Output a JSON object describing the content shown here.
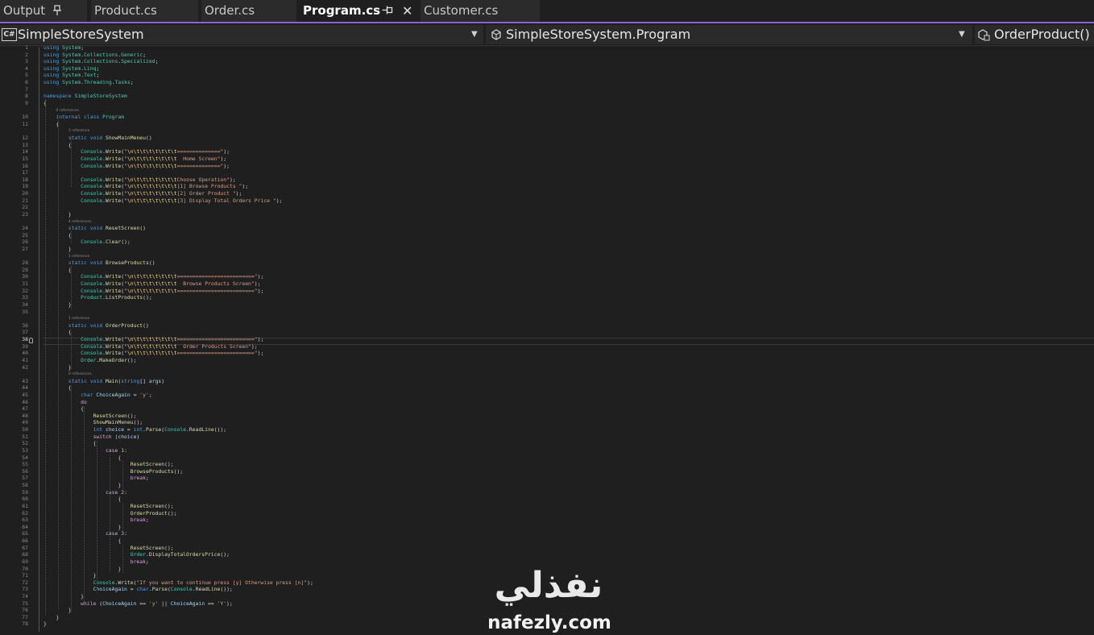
{
  "tabs": [
    {
      "label": "Output",
      "pinned": true,
      "active": false
    },
    {
      "label": "Product.cs",
      "active": false
    },
    {
      "label": "Order.cs",
      "active": false
    },
    {
      "label": "Program.cs",
      "active": true,
      "pinned": true,
      "closable": true
    },
    {
      "label": "Customer.cs",
      "active": false
    }
  ],
  "navbar": {
    "project": "SimpleStoreSystem",
    "project_icon": "C#",
    "class": "SimpleStoreSystem.Program",
    "member": "OrderProduct()"
  },
  "editor": {
    "current_line": 38,
    "colors": {
      "keyword": "#569cd6",
      "type": "#4ec9b0",
      "method": "#dcdcaa",
      "string": "#d69d85",
      "control": "#d8a0df"
    },
    "lines": [
      {
        "n": 1,
        "t": "using System;"
      },
      {
        "n": 2,
        "t": "using System.Collections.Generic;"
      },
      {
        "n": 3,
        "t": "using System.Collections.Specialized;"
      },
      {
        "n": 4,
        "t": "using System.Linq;"
      },
      {
        "n": 5,
        "t": "using System.Text;"
      },
      {
        "n": 6,
        "t": "using System.Threading.Tasks;"
      },
      {
        "n": 7,
        "t": ""
      },
      {
        "n": 8,
        "t": "namespace SimpleStoreSystem"
      },
      {
        "n": 9,
        "t": "{"
      },
      {
        "n": 10,
        "t": "    internal class Program",
        "hint": "0 references"
      },
      {
        "n": 11,
        "t": "    {"
      },
      {
        "n": 12,
        "t": "        static void ShowMainMeneu()",
        "hint": "1 reference"
      },
      {
        "n": 13,
        "t": "        {"
      },
      {
        "n": 14,
        "t": "            Console.Write(\"\\n\\t\\t\\t\\t\\t\\t\\t==============\");"
      },
      {
        "n": 15,
        "t": "            Console.Write(\"\\n\\t\\t\\t\\t\\t\\t\\t  Home Screen\");"
      },
      {
        "n": 16,
        "t": "            Console.Write(\"\\n\\t\\t\\t\\t\\t\\t\\t==============\");"
      },
      {
        "n": 17,
        "t": ""
      },
      {
        "n": 18,
        "t": "            Console.Write(\"\\n\\t\\t\\t\\t\\t\\t\\tChoose Operation\");"
      },
      {
        "n": 19,
        "t": "            Console.Write(\"\\n\\t\\t\\t\\t\\t\\t\\t[1] Browse Products \");"
      },
      {
        "n": 20,
        "t": "            Console.Write(\"\\n\\t\\t\\t\\t\\t\\t\\t[2] Order Product \");"
      },
      {
        "n": 21,
        "t": "            Console.Write(\"\\n\\t\\t\\t\\t\\t\\t\\t[3] Display Total Orders Price \");"
      },
      {
        "n": 22,
        "t": ""
      },
      {
        "n": 23,
        "t": "        }"
      },
      {
        "n": 24,
        "t": "        static void ResetScreen()",
        "hint": "4 references"
      },
      {
        "n": 25,
        "t": "        {"
      },
      {
        "n": 26,
        "t": "            Console.Clear();"
      },
      {
        "n": 27,
        "t": "        }"
      },
      {
        "n": 28,
        "t": "        static void BrowseProducts()",
        "hint": "1 reference"
      },
      {
        "n": 29,
        "t": "        {"
      },
      {
        "n": 30,
        "t": "            Console.Write(\"\\n\\t\\t\\t\\t\\t\\t\\t=========================\");"
      },
      {
        "n": 31,
        "t": "            Console.Write(\"\\n\\t\\t\\t\\t\\t\\t\\t  Browse Products Screen\");"
      },
      {
        "n": 32,
        "t": "            Console.Write(\"\\n\\t\\t\\t\\t\\t\\t\\t=========================\");"
      },
      {
        "n": 33,
        "t": "            Product.ListProducts();"
      },
      {
        "n": 34,
        "t": "        }"
      },
      {
        "n": 35,
        "t": ""
      },
      {
        "n": 36,
        "t": "        static void OrderProduct()",
        "hint": "1 reference"
      },
      {
        "n": 37,
        "t": "        {"
      },
      {
        "n": 38,
        "t": "            Console.Write(\"\\n\\t\\t\\t\\t\\t\\t\\t=========================\");"
      },
      {
        "n": 39,
        "t": "            Console.Write(\"\\n\\t\\t\\t\\t\\t\\t\\t  Order Products Screen\");"
      },
      {
        "n": 40,
        "t": "            Console.Write(\"\\n\\t\\t\\t\\t\\t\\t\\t=========================\");"
      },
      {
        "n": 41,
        "t": "            Order.MakeOrder();"
      },
      {
        "n": 42,
        "t": "        }"
      },
      {
        "n": 43,
        "t": "        static void Main(string[] args)",
        "hint": "0 references"
      },
      {
        "n": 44,
        "t": "        {"
      },
      {
        "n": 45,
        "t": "            char ChoiceAgain = 'y';"
      },
      {
        "n": 46,
        "t": "            do"
      },
      {
        "n": 47,
        "t": "            {"
      },
      {
        "n": 48,
        "t": "                ResetScreen();"
      },
      {
        "n": 49,
        "t": "                ShowMainMeneu();"
      },
      {
        "n": 50,
        "t": "                int choice = int.Parse(Console.ReadLine());"
      },
      {
        "n": 51,
        "t": "                switch (choice)"
      },
      {
        "n": 52,
        "t": "                {"
      },
      {
        "n": 53,
        "t": "                    case 1:"
      },
      {
        "n": 54,
        "t": "                        {"
      },
      {
        "n": 55,
        "t": "                            ResetScreen();"
      },
      {
        "n": 56,
        "t": "                            BrowseProducts();"
      },
      {
        "n": 57,
        "t": "                            break;"
      },
      {
        "n": 58,
        "t": "                        }"
      },
      {
        "n": 59,
        "t": "                    case 2:"
      },
      {
        "n": 60,
        "t": "                        {"
      },
      {
        "n": 61,
        "t": "                            ResetScreen();"
      },
      {
        "n": 62,
        "t": "                            OrderProduct();"
      },
      {
        "n": 63,
        "t": "                            break;"
      },
      {
        "n": 64,
        "t": "                        }"
      },
      {
        "n": 65,
        "t": "                    case 3:"
      },
      {
        "n": 66,
        "t": "                        {"
      },
      {
        "n": 67,
        "t": "                            ResetScreen();"
      },
      {
        "n": 68,
        "t": "                            Order.DisplayTotalOrdersPrice();"
      },
      {
        "n": 69,
        "t": "                            break;"
      },
      {
        "n": 70,
        "t": "                        }"
      },
      {
        "n": 71,
        "t": "                }"
      },
      {
        "n": 72,
        "t": "                Console.Write(\"If you want to continue press [y] Otherwise press [n]\");"
      },
      {
        "n": 73,
        "t": "                ChoiceAgain = char.Parse(Console.ReadLine());"
      },
      {
        "n": 74,
        "t": "            }"
      },
      {
        "n": 75,
        "t": "            while (ChoiceAgain == 'y' || ChoiceAgain == 'Y');"
      },
      {
        "n": 76,
        "t": "        }"
      },
      {
        "n": 77,
        "t": "    }"
      },
      {
        "n": 78,
        "t": "}"
      }
    ]
  },
  "watermark": {
    "arabic": "نفذلي",
    "latin": "nafezly.com"
  }
}
